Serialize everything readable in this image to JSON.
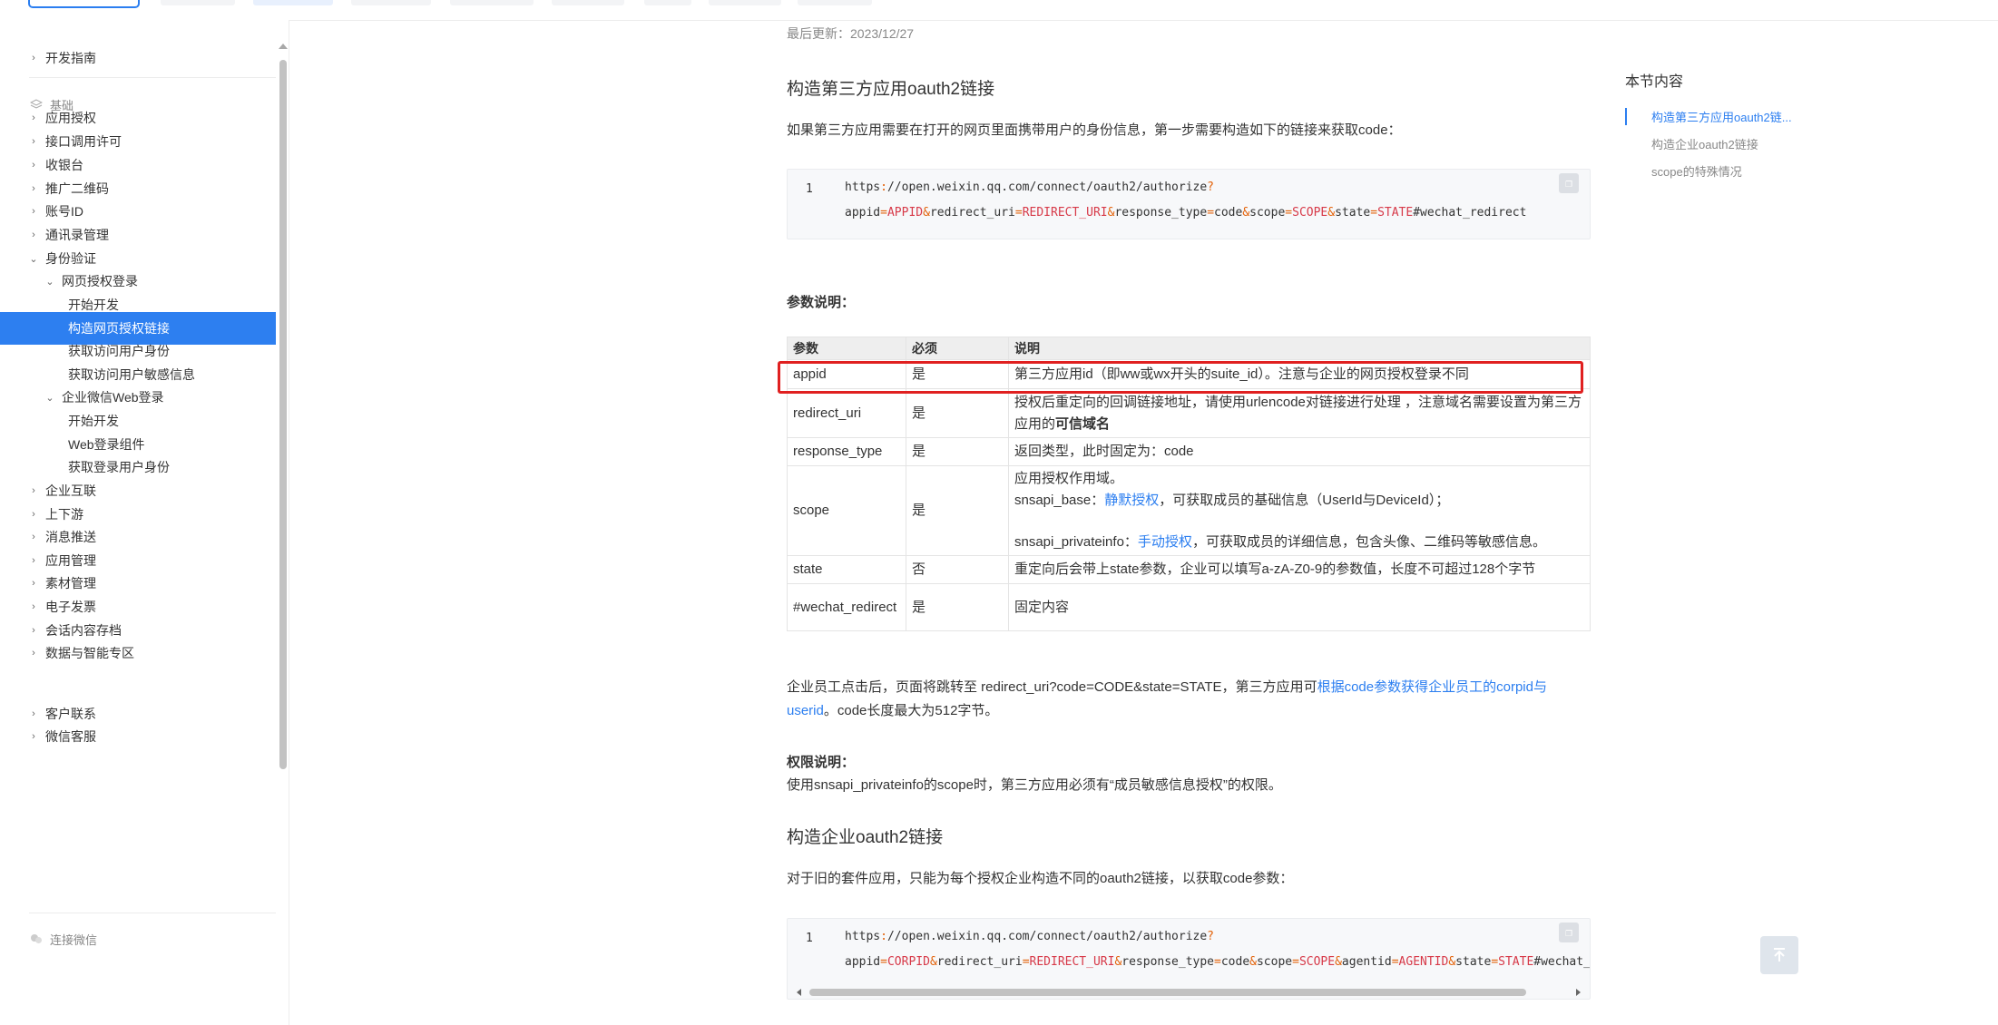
{
  "colors": {
    "accent": "#2d7ff0",
    "highlight": "#e02020"
  },
  "sidebar": {
    "items": [
      {
        "label": "开发指南",
        "arrow": "›",
        "level": 0
      },
      {
        "label": "应用授权",
        "arrow": "›",
        "level": 0
      },
      {
        "label": "接口调用许可",
        "arrow": "›",
        "level": 0
      },
      {
        "label": "收银台",
        "arrow": "›",
        "level": 0
      },
      {
        "label": "推广二维码",
        "arrow": "›",
        "level": 0
      },
      {
        "label": "账号ID",
        "arrow": "›",
        "level": 0
      },
      {
        "label": "通讯录管理",
        "arrow": "›",
        "level": 0
      },
      {
        "label": "身份验证",
        "arrow": "⌄",
        "level": 0
      },
      {
        "label": "网页授权登录",
        "arrow": "⌄",
        "level": 1
      },
      {
        "label": "开始开发",
        "arrow": "",
        "level": 2
      },
      {
        "label": "构造网页授权链接",
        "arrow": "",
        "level": 2,
        "active": true
      },
      {
        "label": "获取访问用户身份",
        "arrow": "",
        "level": 2
      },
      {
        "label": "获取访问用户敏感信息",
        "arrow": "",
        "level": 2
      },
      {
        "label": "企业微信Web登录",
        "arrow": "⌄",
        "level": 1
      },
      {
        "label": "开始开发",
        "arrow": "",
        "level": 2
      },
      {
        "label": "Web登录组件",
        "arrow": "",
        "level": 2
      },
      {
        "label": "获取登录用户身份",
        "arrow": "",
        "level": 2
      },
      {
        "label": "企业互联",
        "arrow": "›",
        "level": 0
      },
      {
        "label": "上下游",
        "arrow": "›",
        "level": 0
      },
      {
        "label": "消息推送",
        "arrow": "›",
        "level": 0
      },
      {
        "label": "应用管理",
        "arrow": "›",
        "level": 0
      },
      {
        "label": "素材管理",
        "arrow": "›",
        "level": 0
      },
      {
        "label": "电子发票",
        "arrow": "›",
        "level": 0
      },
      {
        "label": "会话内容存档",
        "arrow": "›",
        "level": 0
      },
      {
        "label": "数据与智能专区",
        "arrow": "›",
        "level": 0
      },
      {
        "label": "客户联系",
        "arrow": "›",
        "level": 0
      },
      {
        "label": "微信客服",
        "arrow": "›",
        "level": 0
      }
    ],
    "sections": [
      {
        "label": "基础",
        "icon": "layers-icon"
      },
      {
        "label": "连接微信",
        "icon": "wechat-icon"
      }
    ]
  },
  "main": {
    "updated": "最后更新：2023/12/27",
    "h1": "构造第三方应用oauth2链接",
    "intro": "如果第三方应用需要在打开的网页里面携带用户的身份信息，第一步需要构造如下的链接来获取code：",
    "code1": {
      "line_no": "1",
      "l1_a": "https",
      "l1_b": ":",
      "l1_c": "//open.weixin.qq.com/connect/oauth2/authorize",
      "l1_d": "?",
      "l2_a": "appid",
      "l2_b": "=",
      "l2_c": "APPID",
      "l2_d": "&",
      "l2_e": "redirect_uri",
      "l2_f": "=",
      "l2_g": "REDIRECT_URI",
      "l2_h": "&",
      "l2_i": "response_type",
      "l2_j": "=",
      "l2_k": "code",
      "l2_l": "&",
      "l2_m": "scope",
      "l2_n": "=",
      "l2_o": "SCOPE",
      "l2_p": "&",
      "l2_q": "state",
      "l2_r": "=",
      "l2_s": "STATE",
      "l2_t": "#wechat_redirect"
    },
    "params_title": "参数说明：",
    "table": {
      "headers": [
        "参数",
        "必须",
        "说明"
      ],
      "rows": [
        {
          "param": "appid",
          "required": "是",
          "desc": "第三方应用id（即ww或wx开头的suite_id）。注意与企业的网页授权登录不同"
        },
        {
          "param": "redirect_uri",
          "required": "是",
          "desc_a": "授权后重定向的回调链接地址，请使用urlencode对链接进行处理 ，注意域名需要设置为第三方应用的",
          "desc_b": "可信域名"
        },
        {
          "param": "response_type",
          "required": "是",
          "desc": "返回类型，此时固定为：code"
        },
        {
          "param": "scope",
          "required": "是",
          "desc_l1": "应用授权作用域。",
          "desc_l2a": "snsapi_base：",
          "desc_l2b": "静默授权",
          "desc_l2c": "，可获取成员的基础信息（UserId与DeviceId）；",
          "desc_l3a": "snsapi_privateinfo：",
          "desc_l3b": "手动授权",
          "desc_l3c": "，可获取成员的详细信息，包含头像、二维码等敏感信息。"
        },
        {
          "param": "state",
          "required": "否",
          "desc": "重定向后会带上state参数，企业可以填写a-zA-Z0-9的参数值，长度不可超过128个字节"
        },
        {
          "param": "#wechat_redirect",
          "required": "是",
          "desc": "固定内容"
        }
      ]
    },
    "after_a": "企业员工点击后，页面将跳转至 redirect_uri?code=CODE&state=STATE，第三方应用可",
    "after_link": "根据code参数获得企业员工的corpid与userid",
    "after_b": "。code长度最大为512字节。",
    "perm_title": "权限说明：",
    "perm_text": "使用snsapi_privateinfo的scope时，第三方应用必须有“成员敏感信息授权”的权限。",
    "h2": "构造企业oauth2链接",
    "intro2": "对于旧的套件应用，只能为每个授权企业构造不同的oauth2链接，以获取code参数：",
    "code2": {
      "line_no": "1",
      "l1_a": "https",
      "l1_b": ":",
      "l1_c": "//open.weixin.qq.com/connect/oauth2/authorize",
      "l1_d": "?",
      "l2_a": "appid",
      "l2_b": "=",
      "l2_c": "CORPID",
      "l2_d": "&",
      "l2_e": "redirect_uri",
      "l2_f": "=",
      "l2_g": "REDIRECT_URI",
      "l2_h": "&",
      "l2_i": "response_type",
      "l2_j": "=",
      "l2_k": "code",
      "l2_l": "&",
      "l2_m": "scope",
      "l2_n": "=",
      "l2_o": "SCOPE",
      "l2_p": "&",
      "l2_q": "agentid",
      "l2_r": "=",
      "l2_s": "AGENTID",
      "l2_t": "&",
      "l2_u": "state",
      "l2_v": "=",
      "l2_w": "STATE",
      "l2_x": "#wechat_re"
    }
  },
  "toc": {
    "title": "本节内容",
    "items": [
      "构造第三方应用oauth2链...",
      "构造企业oauth2链接",
      "scope的特殊情况"
    ]
  }
}
